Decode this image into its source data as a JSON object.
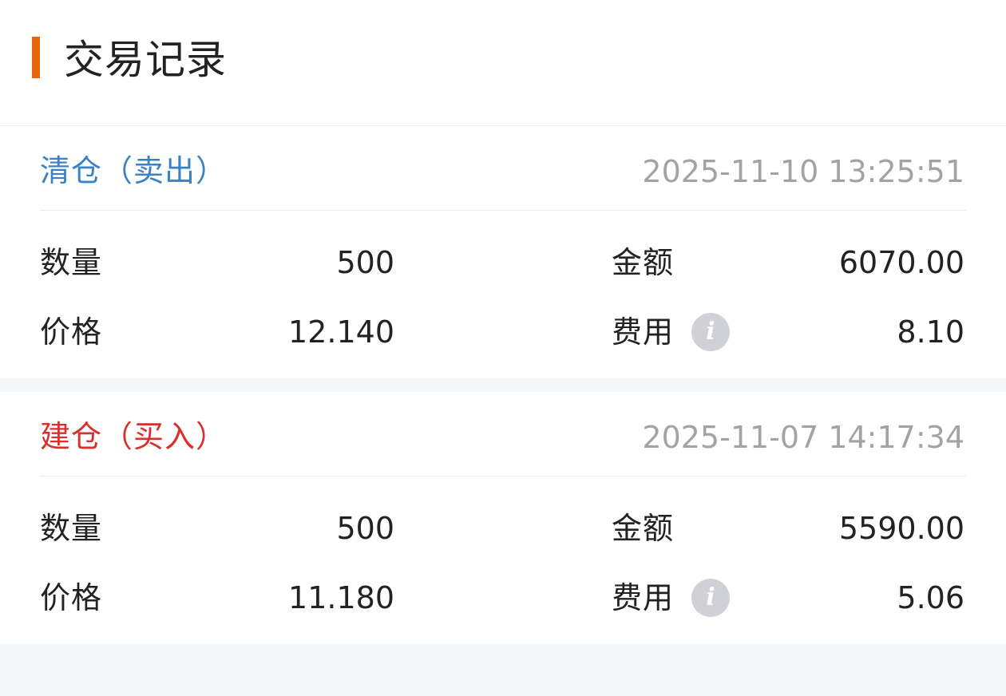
{
  "header": {
    "title": "交易记录",
    "accent_color": "#e8650f"
  },
  "records": [
    {
      "type_label": "清仓（卖出）",
      "type_color": "#3a82c6",
      "datetime": "2025-11-10 13:25:51",
      "quantity_label": "数量",
      "quantity": "500",
      "amount_label": "金额",
      "amount": "6070.00",
      "price_label": "价格",
      "price": "12.140",
      "fee_label": "费用",
      "fee": "8.10",
      "fee_info_icon": "info-icon",
      "fee_info_glyph": "i"
    },
    {
      "type_label": "建仓（买入）",
      "type_color": "#d9302c",
      "datetime": "2025-11-07 14:17:34",
      "quantity_label": "数量",
      "quantity": "500",
      "amount_label": "金额",
      "amount": "5590.00",
      "price_label": "价格",
      "price": "11.180",
      "fee_label": "费用",
      "fee": "5.06",
      "fee_info_icon": "info-icon",
      "fee_info_glyph": "i"
    }
  ]
}
